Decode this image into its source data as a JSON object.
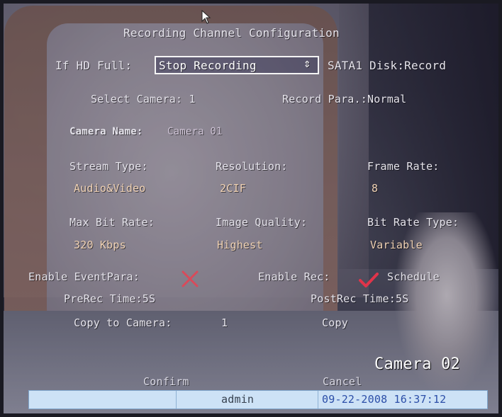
{
  "title": "Recording Channel Configuration",
  "hd_full": {
    "label": "If HD Full:",
    "value": "Stop Recording",
    "arrow": "⇕",
    "disk_status": "SATA1 Disk:Record"
  },
  "camera": {
    "select_label": "Select Camera:",
    "select_value": "1",
    "record_para_label": "Record Para.:",
    "record_para_value": "Normal",
    "name_label": "Camera Name:",
    "name_value": "Camera 01"
  },
  "params": {
    "stream_type_label": "Stream Type:",
    "stream_type_value": "Audio&Video",
    "resolution_label": "Resolution:",
    "resolution_value": "2CIF",
    "frame_rate_label": "Frame Rate:",
    "frame_rate_value": "8",
    "max_bit_rate_label": "Max Bit Rate:",
    "max_bit_rate_value": "320 Kbps",
    "image_quality_label": "Image Quality:",
    "image_quality_value": "Highest",
    "bit_rate_type_label": "Bit Rate Type:",
    "bit_rate_type_value": "Variable"
  },
  "event": {
    "enable_eventpara_label": "Enable EventPara:",
    "enable_eventpara_icon": "cross-icon",
    "enable_rec_label": "Enable Rec:",
    "enable_rec_icon": "check-icon",
    "schedule_label": "Schedule",
    "prerec_label": "PreRec Time:",
    "prerec_value": "5S",
    "postrec_label": "PostRec Time:",
    "postrec_value": "5S",
    "copy_to_label": "Copy to Camera:",
    "copy_to_value": "1",
    "copy_button": "Copy"
  },
  "footer": {
    "confirm": "Confirm",
    "cancel": "Cancel",
    "camera_label": "Camera 02"
  },
  "statusbar": {
    "user": "admin",
    "datetime": "09-22-2008 16:37:12"
  },
  "colors": {
    "check": "#e0344a",
    "cross": "#d94a5a",
    "statusbar_bg": "#cde2f6"
  }
}
